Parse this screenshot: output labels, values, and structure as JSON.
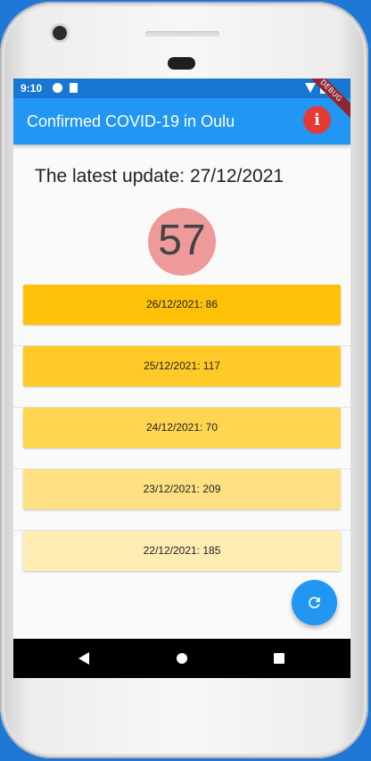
{
  "status_bar": {
    "time": "9:10",
    "left_icons": [
      "app-icon",
      "sd-card-icon"
    ],
    "right_icons": [
      "wifi-icon",
      "battery-icon"
    ]
  },
  "app_bar": {
    "title": "Confirmed COVID-19 in Oulu",
    "info_icon": "info-icon",
    "debug_label": "DEBUG"
  },
  "main": {
    "latest_update": "The latest update: 27/12/2021",
    "latest_count": "57",
    "history": [
      {
        "label": "26/12/2021: 86",
        "color": "#FFC107"
      },
      {
        "label": "25/12/2021: 117",
        "color": "#FFCA28"
      },
      {
        "label": "24/12/2021: 70",
        "color": "#FFD54F"
      },
      {
        "label": "23/12/2021: 209",
        "color": "#FFE082"
      },
      {
        "label": "22/12/2021: 185",
        "color": "#FFECB3"
      }
    ],
    "refresh_icon": "refresh-icon"
  },
  "nav_bar": {
    "icons": [
      "back-icon",
      "home-icon",
      "recent-apps-icon"
    ]
  },
  "colors": {
    "app_bar": "#2196F3",
    "status_bar": "#1976D2",
    "count_circle": "#EF9A9A",
    "info_button": "#E53935"
  }
}
